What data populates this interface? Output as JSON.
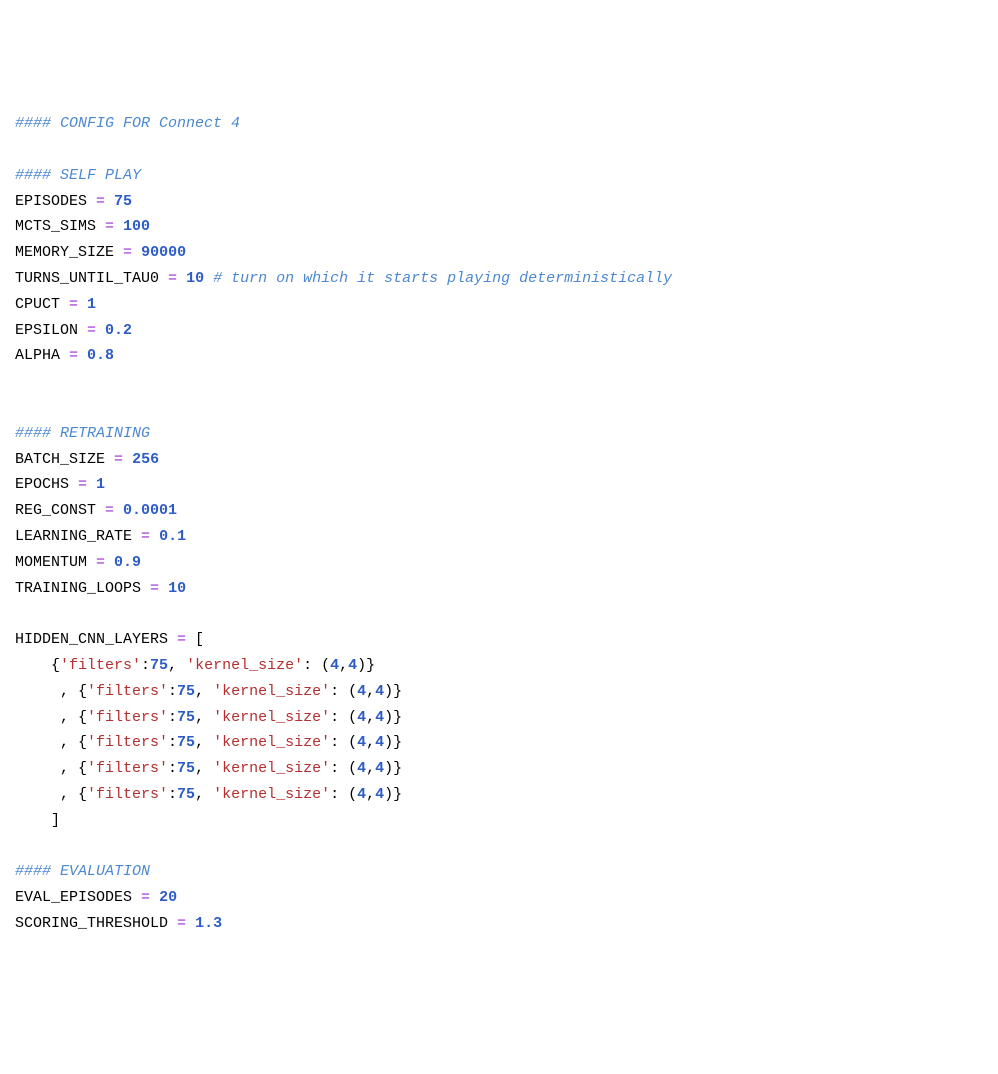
{
  "lines": [
    [
      [
        "c",
        "#### CONFIG FOR Connect 4"
      ]
    ],
    [],
    [
      [
        "c",
        "#### SELF PLAY"
      ]
    ],
    [
      [
        "v",
        "EPISODES "
      ],
      [
        "op",
        "="
      ],
      [
        "v",
        " "
      ],
      [
        "num",
        "75"
      ]
    ],
    [
      [
        "v",
        "MCTS_SIMS "
      ],
      [
        "op",
        "="
      ],
      [
        "v",
        " "
      ],
      [
        "num",
        "100"
      ]
    ],
    [
      [
        "v",
        "MEMORY_SIZE "
      ],
      [
        "op",
        "="
      ],
      [
        "v",
        " "
      ],
      [
        "num",
        "90000"
      ]
    ],
    [
      [
        "v",
        "TURNS_UNTIL_TAU0 "
      ],
      [
        "op",
        "="
      ],
      [
        "v",
        " "
      ],
      [
        "num",
        "10"
      ],
      [
        "v",
        " "
      ],
      [
        "c",
        "# turn on which it starts playing deterministically"
      ]
    ],
    [
      [
        "v",
        "CPUCT "
      ],
      [
        "op",
        "="
      ],
      [
        "v",
        " "
      ],
      [
        "num",
        "1"
      ]
    ],
    [
      [
        "v",
        "EPSILON "
      ],
      [
        "op",
        "="
      ],
      [
        "v",
        " "
      ],
      [
        "num",
        "0.2"
      ]
    ],
    [
      [
        "v",
        "ALPHA "
      ],
      [
        "op",
        "="
      ],
      [
        "v",
        " "
      ],
      [
        "num",
        "0.8"
      ]
    ],
    [],
    [],
    [
      [
        "c",
        "#### RETRAINING"
      ]
    ],
    [
      [
        "v",
        "BATCH_SIZE "
      ],
      [
        "op",
        "="
      ],
      [
        "v",
        " "
      ],
      [
        "num",
        "256"
      ]
    ],
    [
      [
        "v",
        "EPOCHS "
      ],
      [
        "op",
        "="
      ],
      [
        "v",
        " "
      ],
      [
        "num",
        "1"
      ]
    ],
    [
      [
        "v",
        "REG_CONST "
      ],
      [
        "op",
        "="
      ],
      [
        "v",
        " "
      ],
      [
        "num",
        "0.0001"
      ]
    ],
    [
      [
        "v",
        "LEARNING_RATE "
      ],
      [
        "op",
        "="
      ],
      [
        "v",
        " "
      ],
      [
        "num",
        "0.1"
      ]
    ],
    [
      [
        "v",
        "MOMENTUM "
      ],
      [
        "op",
        "="
      ],
      [
        "v",
        " "
      ],
      [
        "num",
        "0.9"
      ]
    ],
    [
      [
        "v",
        "TRAINING_LOOPS "
      ],
      [
        "op",
        "="
      ],
      [
        "v",
        " "
      ],
      [
        "num",
        "10"
      ]
    ],
    [],
    [
      [
        "v",
        "HIDDEN_CNN_LAYERS "
      ],
      [
        "op",
        "="
      ],
      [
        "v",
        " ["
      ]
    ],
    [
      [
        "v",
        "    {"
      ],
      [
        "str",
        "'filters'"
      ],
      [
        "p",
        ":"
      ],
      [
        "num",
        "75"
      ],
      [
        "p",
        ", "
      ],
      [
        "str",
        "'kernel_size'"
      ],
      [
        "p",
        ": ("
      ],
      [
        "num",
        "4"
      ],
      [
        "p",
        ","
      ],
      [
        "num",
        "4"
      ],
      [
        "p",
        ")}"
      ]
    ],
    [
      [
        "v",
        "     , {"
      ],
      [
        "str",
        "'filters'"
      ],
      [
        "p",
        ":"
      ],
      [
        "num",
        "75"
      ],
      [
        "p",
        ", "
      ],
      [
        "str",
        "'kernel_size'"
      ],
      [
        "p",
        ": ("
      ],
      [
        "num",
        "4"
      ],
      [
        "p",
        ","
      ],
      [
        "num",
        "4"
      ],
      [
        "p",
        ")}"
      ]
    ],
    [
      [
        "v",
        "     , {"
      ],
      [
        "str",
        "'filters'"
      ],
      [
        "p",
        ":"
      ],
      [
        "num",
        "75"
      ],
      [
        "p",
        ", "
      ],
      [
        "str",
        "'kernel_size'"
      ],
      [
        "p",
        ": ("
      ],
      [
        "num",
        "4"
      ],
      [
        "p",
        ","
      ],
      [
        "num",
        "4"
      ],
      [
        "p",
        ")}"
      ]
    ],
    [
      [
        "v",
        "     , {"
      ],
      [
        "str",
        "'filters'"
      ],
      [
        "p",
        ":"
      ],
      [
        "num",
        "75"
      ],
      [
        "p",
        ", "
      ],
      [
        "str",
        "'kernel_size'"
      ],
      [
        "p",
        ": ("
      ],
      [
        "num",
        "4"
      ],
      [
        "p",
        ","
      ],
      [
        "num",
        "4"
      ],
      [
        "p",
        ")}"
      ]
    ],
    [
      [
        "v",
        "     , {"
      ],
      [
        "str",
        "'filters'"
      ],
      [
        "p",
        ":"
      ],
      [
        "num",
        "75"
      ],
      [
        "p",
        ", "
      ],
      [
        "str",
        "'kernel_size'"
      ],
      [
        "p",
        ": ("
      ],
      [
        "num",
        "4"
      ],
      [
        "p",
        ","
      ],
      [
        "num",
        "4"
      ],
      [
        "p",
        ")}"
      ]
    ],
    [
      [
        "v",
        "     , {"
      ],
      [
        "str",
        "'filters'"
      ],
      [
        "p",
        ":"
      ],
      [
        "num",
        "75"
      ],
      [
        "p",
        ", "
      ],
      [
        "str",
        "'kernel_size'"
      ],
      [
        "p",
        ": ("
      ],
      [
        "num",
        "4"
      ],
      [
        "p",
        ","
      ],
      [
        "num",
        "4"
      ],
      [
        "p",
        ")}"
      ]
    ],
    [
      [
        "v",
        "    ]"
      ]
    ],
    [],
    [
      [
        "c",
        "#### EVALUATION"
      ]
    ],
    [
      [
        "v",
        "EVAL_EPISODES "
      ],
      [
        "op",
        "="
      ],
      [
        "v",
        " "
      ],
      [
        "num",
        "20"
      ]
    ],
    [
      [
        "v",
        "SCORING_THRESHOLD "
      ],
      [
        "op",
        "="
      ],
      [
        "v",
        " "
      ],
      [
        "num",
        "1.3"
      ]
    ]
  ]
}
